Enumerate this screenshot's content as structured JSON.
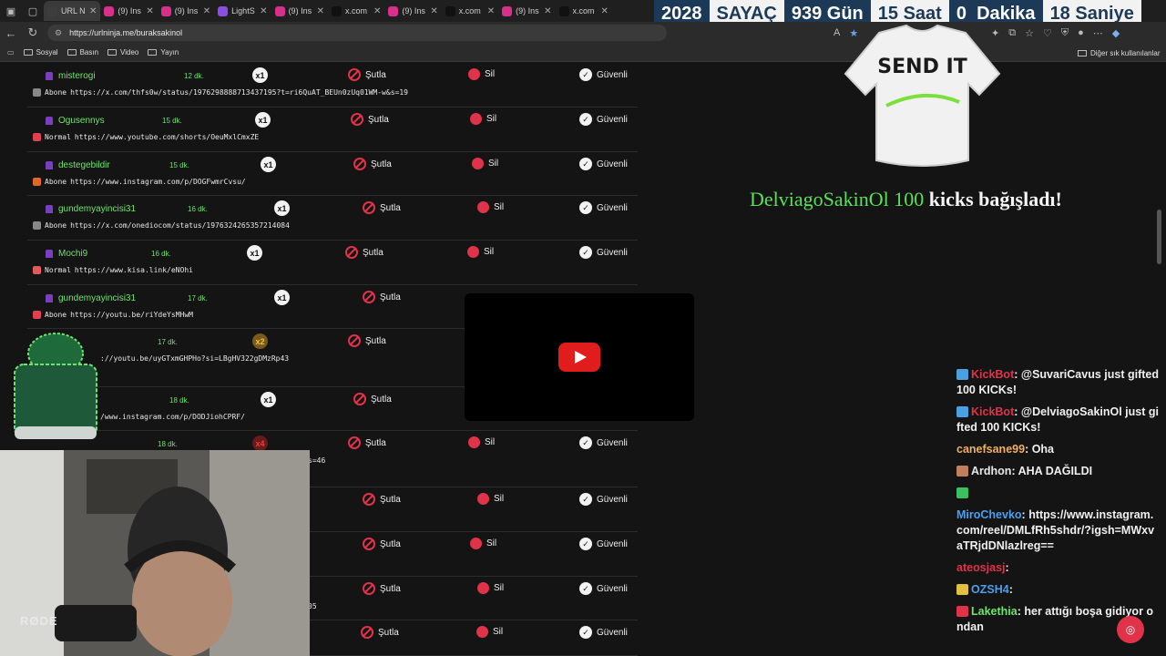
{
  "tabs": [
    {
      "title": "URL N",
      "fav": "link-icon",
      "color": "#3d3d3d",
      "active": true
    },
    {
      "title": "(9) Ins",
      "fav": "instagram-icon",
      "color": "#d6308a"
    },
    {
      "title": "(9) Ins",
      "fav": "instagram-icon",
      "color": "#d6308a"
    },
    {
      "title": "LightS",
      "fav": "lightshot-icon",
      "color": "#8a4fe0"
    },
    {
      "title": "(9) Ins",
      "fav": "instagram-icon",
      "color": "#d6308a"
    },
    {
      "title": "x.com",
      "fav": "x-icon",
      "color": "#111111"
    },
    {
      "title": "(9) Ins",
      "fav": "instagram-icon",
      "color": "#d6308a"
    },
    {
      "title": "x.com",
      "fav": "x-icon",
      "color": "#111111"
    },
    {
      "title": "(9) Ins",
      "fav": "instagram-icon",
      "color": "#d6308a"
    },
    {
      "title": "x.com",
      "fav": "x-icon",
      "color": "#111111"
    }
  ],
  "counter": {
    "year": "2028",
    "label": "SAYAÇ",
    "days": "939 Gün",
    "hours": "15 Saat",
    "minutes": "0  Dakika",
    "seconds": "18 Saniye"
  },
  "address": {
    "url": "https://urlninja.me/buraksakinol"
  },
  "bookmarks": {
    "items": [
      "Sosyal",
      "Basın",
      "Video",
      "Yayın"
    ],
    "other": "Diğer sık kullanılanlar"
  },
  "actions": {
    "kick": "Şutla",
    "delete": "Sil",
    "safe": "Güvenli"
  },
  "rows": [
    {
      "user": "misterogi",
      "time": "12 dk.",
      "count": "x1",
      "type": "Abone",
      "src": "x",
      "url": "https://x.com/thfs0w/status/1976298888713437195?t=ri6QuAT_BEUn0zUq01WM-w&s=19",
      "tpos": 172,
      "cpos": 247,
      "kpos": 352,
      "dpos": 484,
      "spos": 606,
      "sil": true,
      "ok": true
    },
    {
      "user": "Ogusennys",
      "time": "15 dk.",
      "count": "x1",
      "type": "Normal",
      "src": "yt",
      "url": "https://www.youtube.com/shorts/OeuMxlCmxZE",
      "tpos": 148,
      "cpos": 250,
      "kpos": 355,
      "dpos": 486,
      "spos": 606,
      "sil": true,
      "ok": true
    },
    {
      "user": "destegebildir",
      "time": "15 dk.",
      "count": "x1",
      "type": "Abone",
      "src": "ig",
      "url": "https://www.instagram.com/p/DOGFwmrCvsu/",
      "tpos": 156,
      "cpos": 256,
      "kpos": 358,
      "dpos": 488,
      "spos": 606,
      "sil": true,
      "ok": true
    },
    {
      "user": "gundemyayincisi31",
      "time": "16 dk.",
      "count": "x1",
      "type": "Abone",
      "src": "x",
      "url": "https://x.com/onediocom/status/1976324265357214084",
      "tpos": 176,
      "cpos": 271,
      "kpos": 368,
      "dpos": 494,
      "spos": 606,
      "sil": true,
      "ok": true
    },
    {
      "user": "Mochi9",
      "time": "16 dk.",
      "count": "x1",
      "type": "Normal",
      "src": "ks",
      "url": "https://www.kisa.link/eNOhi",
      "tpos": 136,
      "cpos": 241,
      "kpos": 349,
      "dpos": 483,
      "spos": 606,
      "sil": true,
      "ok": true
    },
    {
      "user": "gundemyayincisi31",
      "time": "17 dk.",
      "count": "x1",
      "type": "Abone",
      "src": "yt",
      "url": "https://youtu.be/riYdeYsMHwM",
      "tpos": 176,
      "cpos": 271,
      "kpos": 368,
      "dpos": 0,
      "spos": 0,
      "sil": false,
      "ok": false
    },
    {
      "user": "",
      "time": "17 dk.",
      "count": "x2",
      "type": "",
      "src": "",
      "url": "://youtu.be/uyGTxmGHPHo?si=LBgHV322gDMzRp43",
      "tpos": 143,
      "cpos": 247,
      "kpos": 352,
      "dpos": 0,
      "spos": 0,
      "sil": false,
      "ok": false
    },
    {
      "user": "",
      "time": "18 dk.",
      "count": "x1",
      "type": "",
      "src": "",
      "url": "/www.instagram.com/p/DODJiohCPRF/",
      "tpos": 156,
      "cpos": 256,
      "kpos": 358,
      "dpos": 0,
      "spos": 0,
      "sil": false,
      "ok": false
    },
    {
      "user": "",
      "time": "18 dk.",
      "count": "x4",
      "type": "",
      "src": "",
      "url": "s=46",
      "tpos": 143,
      "cpos": 247,
      "kpos": 352,
      "dpos": 484,
      "spos": 606,
      "sil": true,
      "ok": true
    },
    {
      "user": "",
      "time": "",
      "count": "",
      "type": "",
      "src": "",
      "url": "",
      "tpos": 0,
      "cpos": 0,
      "kpos": 368,
      "dpos": 494,
      "spos": 606,
      "sil": true,
      "ok": true
    },
    {
      "user": "",
      "time": "",
      "count": "",
      "type": "",
      "src": "",
      "url": "",
      "tpos": 0,
      "cpos": 0,
      "kpos": 368,
      "dpos": 486,
      "spos": 606,
      "sil": true,
      "ok": true
    },
    {
      "user": "",
      "time": "",
      "count": "",
      "type": "",
      "src": "",
      "url": "05",
      "tpos": 0,
      "cpos": 0,
      "kpos": 368,
      "dpos": 494,
      "spos": 606,
      "sil": true,
      "ok": true
    },
    {
      "user": "",
      "time": "",
      "count": "",
      "type": "",
      "src": "",
      "url": "",
      "tpos": 0,
      "cpos": 0,
      "kpos": 366,
      "dpos": 493,
      "spos": 606,
      "sil": true,
      "ok": true
    }
  ],
  "overlay": {
    "shirt_text": "SEND IT",
    "donation_name": "DelviagoSakinOl 100",
    "donation_text": " kicks bağışladı!",
    "cam_label": "RØDE"
  },
  "chat": [
    {
      "name": "KickBot",
      "color": "#e0334a",
      "text": "@SuvariCavus just gifted 100 KICKs!",
      "badge": "#4aa0e0"
    },
    {
      "name": "KickBot",
      "color": "#e0334a",
      "text": "@DelviagoSakinOl just gifted 100 KICKs!",
      "badge": "#4aa0e0"
    },
    {
      "name": "canefsane99",
      "color": "#f0b060",
      "text": "Oha",
      "badge": ""
    },
    {
      "name": "Ardhon",
      "color": "#e8e8e8",
      "text": "AHA DAĞILDI",
      "badge": "#c08060"
    },
    {
      "name": "",
      "color": "#e8e8e8",
      "text": "",
      "badge": "#3ac060"
    },
    {
      "name": "MiroChevko",
      "color": "#4aa0f0",
      "text": "https://www.instagram.com/reel/DMLfRh5shdr/?igsh=MWxvaTRjdDNlazlreg==",
      "badge": ""
    },
    {
      "name": "ateosjasj",
      "color": "#e0334a",
      "text": "",
      "badge": ""
    },
    {
      "name": "OZSH4",
      "color": "#4aa0f0",
      "text": "",
      "badge": "#e0c040"
    },
    {
      "name": "Lakethia",
      "color": "#6fe36f",
      "text": "her attığı boşa gidiyor ondan",
      "badge": "#e0334a"
    }
  ]
}
